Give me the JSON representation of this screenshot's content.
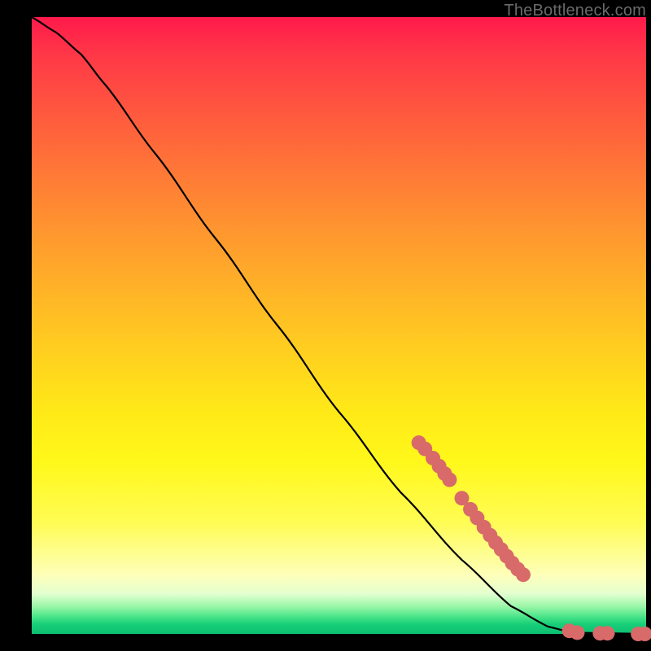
{
  "watermark": "TheBottleneck.com",
  "chart_data": {
    "type": "line",
    "title": "",
    "xlabel": "",
    "ylabel": "",
    "xlim": [
      0,
      100
    ],
    "ylim": [
      0,
      100
    ],
    "grid": false,
    "curve": [
      {
        "x": 0,
        "y": 100
      },
      {
        "x": 4,
        "y": 97.5
      },
      {
        "x": 8,
        "y": 94
      },
      {
        "x": 12,
        "y": 89
      },
      {
        "x": 20,
        "y": 78
      },
      {
        "x": 30,
        "y": 64
      },
      {
        "x": 40,
        "y": 50
      },
      {
        "x": 50,
        "y": 36
      },
      {
        "x": 60,
        "y": 23
      },
      {
        "x": 70,
        "y": 12
      },
      {
        "x": 78,
        "y": 4.5
      },
      {
        "x": 84,
        "y": 1.2
      },
      {
        "x": 88,
        "y": 0.2
      },
      {
        "x": 100,
        "y": 0
      }
    ],
    "marker_color": "#d86a6a",
    "markers": [
      {
        "x": 63,
        "y": 31
      },
      {
        "x": 64,
        "y": 30
      },
      {
        "x": 65.3,
        "y": 28.5
      },
      {
        "x": 66.3,
        "y": 27.2
      },
      {
        "x": 67.2,
        "y": 26
      },
      {
        "x": 68,
        "y": 25
      },
      {
        "x": 70,
        "y": 22
      },
      {
        "x": 71.4,
        "y": 20.2
      },
      {
        "x": 72.5,
        "y": 18.8
      },
      {
        "x": 73.6,
        "y": 17.3
      },
      {
        "x": 74.6,
        "y": 16
      },
      {
        "x": 75.5,
        "y": 14.8
      },
      {
        "x": 76.4,
        "y": 13.7
      },
      {
        "x": 77.3,
        "y": 12.6
      },
      {
        "x": 78.2,
        "y": 11.5
      },
      {
        "x": 79.1,
        "y": 10.5
      },
      {
        "x": 80,
        "y": 9.6
      },
      {
        "x": 87.5,
        "y": 0.5
      },
      {
        "x": 88.8,
        "y": 0.2
      },
      {
        "x": 92.5,
        "y": 0.1
      },
      {
        "x": 93.7,
        "y": 0.1
      },
      {
        "x": 98.7,
        "y": 0
      },
      {
        "x": 99.8,
        "y": 0
      }
    ]
  }
}
